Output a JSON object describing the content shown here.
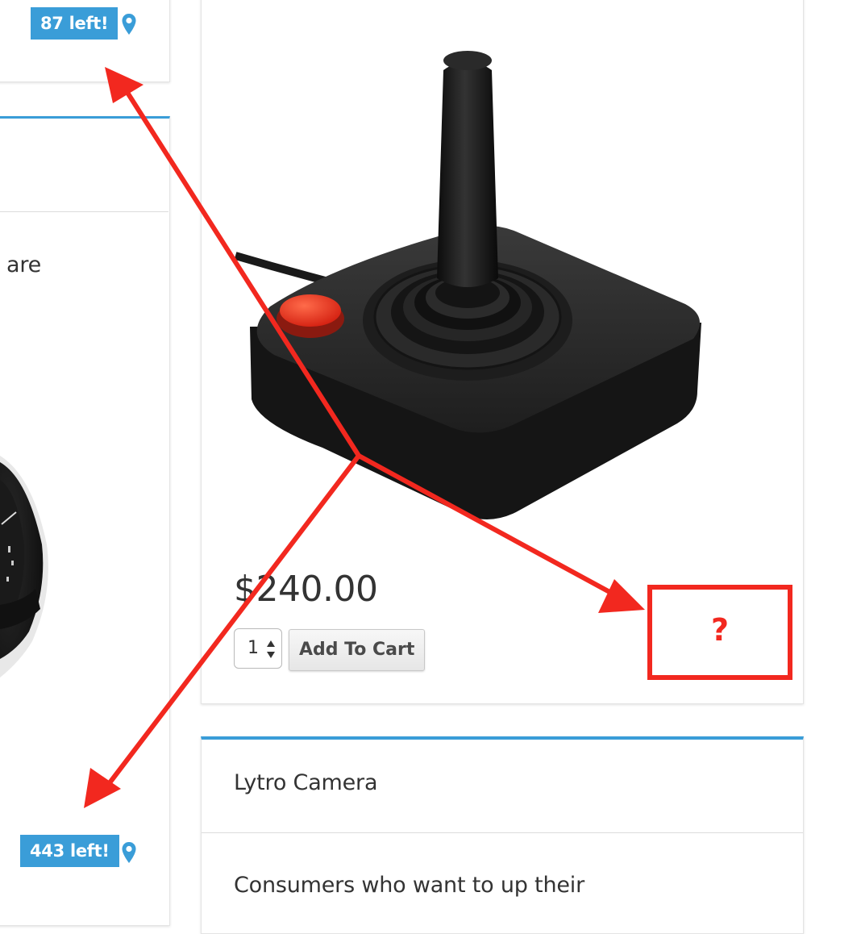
{
  "left_column": {
    "top_badge": {
      "label": "87 left!"
    },
    "partial_text": "are",
    "bottom_badge": {
      "label": "443 left!"
    }
  },
  "featured_product": {
    "image_icon": "joystick-image",
    "price": "$240.00",
    "quantity": "1",
    "add_to_cart_label": "Add To Cart"
  },
  "annotation": {
    "question_mark": "?",
    "color": "#f2281f"
  },
  "next_product": {
    "title": "Lytro Camera",
    "description": "Consumers who want to up their"
  },
  "colors": {
    "accent": "#3a9dd8",
    "text": "#333333",
    "annotation_red": "#f2281f"
  }
}
